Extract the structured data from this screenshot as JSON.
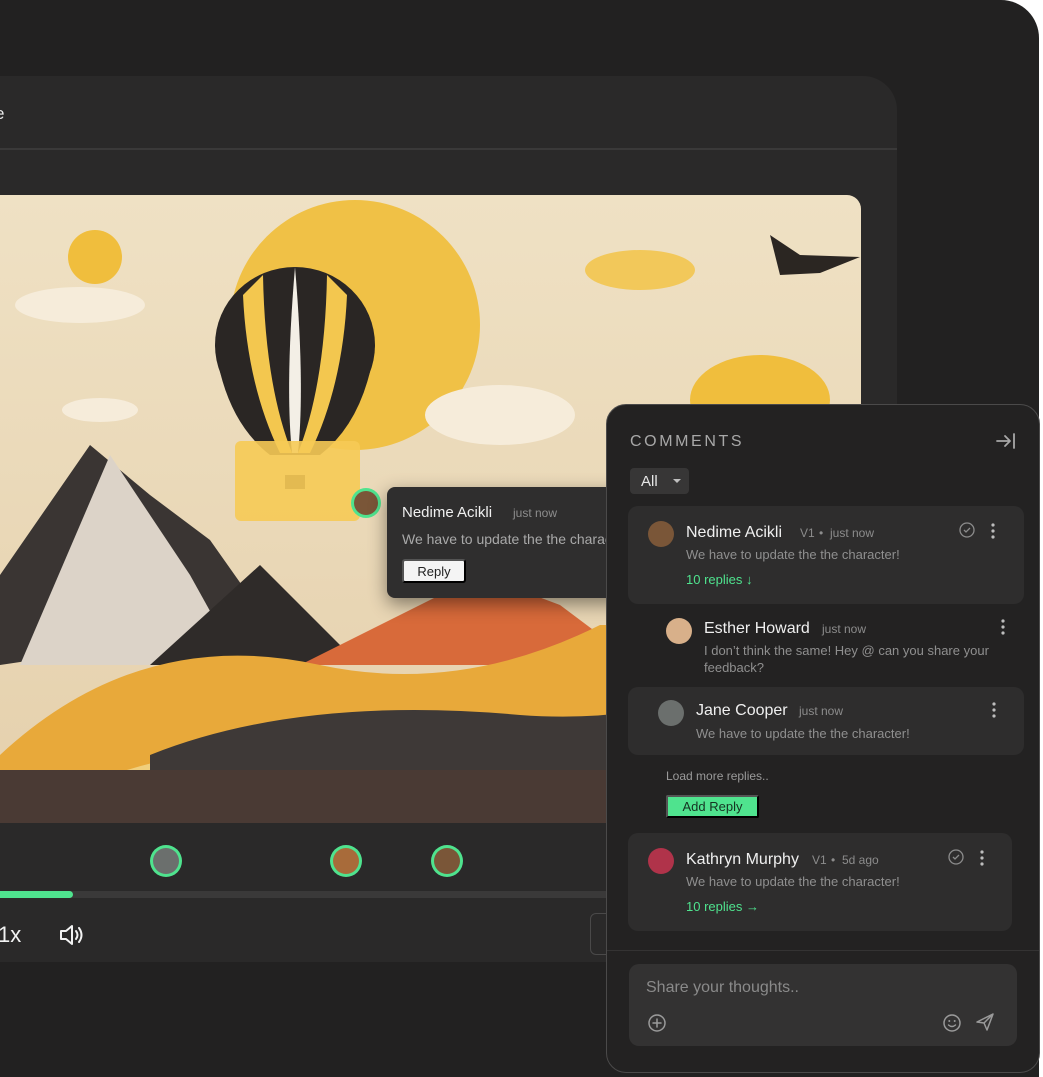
{
  "window": {
    "title": "e"
  },
  "canvas_popup": {
    "author": "Nedime Acikli",
    "time": "just now",
    "message": "We have to update the the character!",
    "reply_label": "Reply"
  },
  "player": {
    "speed_label": "1x",
    "progress_fraction": 0.12,
    "icons": {
      "volume": "volume-icon"
    }
  },
  "comments_panel": {
    "title": "COMMENTS",
    "filter": {
      "selected": "All"
    },
    "icons": {
      "collapse": "collapse-right-icon"
    },
    "threads": [
      {
        "author": "Nedime Acikli",
        "version": "V1",
        "time": "just now",
        "message": "We have to update the the character!",
        "replies_label": "10 replies ↓"
      },
      {
        "author": "Kathryn Murphy",
        "version": "V1",
        "time": "5d ago",
        "message": "We have to update the the character!",
        "replies_label": "10 replies →"
      }
    ],
    "replies": [
      {
        "author": "Esther Howard",
        "time": "just now",
        "message": "I don’t think the same! Hey @ can you share your feedback?"
      },
      {
        "author": "Jane Cooper",
        "time": "just now",
        "message": "We have to update the the character!"
      }
    ],
    "bullet": "•",
    "load_more_label": "Load more replies..",
    "add_reply_label": "Add Reply",
    "composer": {
      "placeholder": "Share your thoughts..",
      "icons": {
        "attach": "add-circle-icon",
        "emoji": "emoji-icon",
        "send": "send-icon"
      }
    }
  },
  "colors": {
    "accent": "#4fe38e",
    "background": "#222121",
    "panel": "#232222",
    "card": "#2e2d2d"
  }
}
